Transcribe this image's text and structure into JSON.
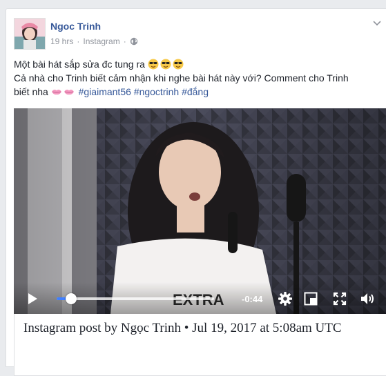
{
  "post": {
    "author": "Ngoc Trinh",
    "time": "19 hrs",
    "separator": "·",
    "source": "Instagram",
    "audience_icon": "globe-icon",
    "options_icon": "chevron-down-icon",
    "text_line1": "Một bài hát sắp sửa đc tung ra",
    "text_line2": "Cả nhà cho Trinh biết cảm nhận khi nghe bài hát này với? Comment cho Trinh",
    "text_line3_prefix": "biết nha",
    "emojis_line1": [
      "sunglasses-emoji",
      "sunglasses-emoji",
      "sunglasses-emoji"
    ],
    "emojis_line3": [
      "kiss-lips-emoji",
      "kiss-lips-emoji"
    ],
    "hashtags": [
      "#giaimant56",
      "#ngoctrinh",
      "#đắng"
    ]
  },
  "video": {
    "remaining_time": "-0:44",
    "progress": 0.09,
    "controls": [
      "play-icon",
      "settings-gear-icon",
      "picture-in-picture-icon",
      "fullscreen-icon",
      "volume-icon"
    ]
  },
  "link_preview": {
    "title": "Instagram post by Ngọc Trinh • Jul 19, 2017 at 5:08am UTC"
  },
  "colors": {
    "link_blue": "#365899",
    "meta_gray": "#90949c",
    "progress_blue": "#4080ff",
    "page_bg": "#e9ebee"
  }
}
